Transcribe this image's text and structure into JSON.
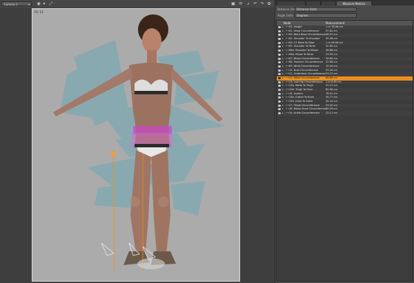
{
  "toolbar": {
    "camera_label": "Camera 1",
    "icons": [
      "pointer-icon",
      "frame-icon",
      "zoom-icon",
      "orbit-icon",
      "pan-icon",
      "roll-icon",
      "frame-all-icon",
      "settings-icon"
    ]
  },
  "viewport": {
    "resolution_label": "F0: 13"
  },
  "panel": {
    "tabs": [
      "",
      "",
      "",
      "Measure Metrics"
    ],
    "distance_units_label": "Distance Units",
    "distance_units_value": "Distance Units",
    "angle_units_label": "Angle Units",
    "angle_units_value": "Degrees",
    "columns": {
      "node": "Node",
      "measurement": "Measurement"
    },
    "rows": [
      {
        "name": "01. Height",
        "value": "1 m 78.58 cm"
      },
      {
        "name": "02. Head Circumference",
        "value": "57.62 cm"
      },
      {
        "name": "03. Neck Base Circumference",
        "value": "38.52 cm"
      },
      {
        "name": "04. Shoulder To Shoulder",
        "value": "39.28 cm"
      },
      {
        "name": "05. C7 Neck To Floor",
        "value": "1 m 48.06 cm"
      },
      {
        "name": "05. Shoulder To Wrist",
        "value": "52.85 cm"
      },
      {
        "name": "06a. Shoulder To Elbow",
        "value": "28.86 cm"
      },
      {
        "name": "06b. Elbow To Wrist",
        "value": "23.99 cm"
      },
      {
        "name": "07. Bicep Circumference",
        "value": "26.69 cm"
      },
      {
        "name": "08. Forearm Circumference",
        "value": "22.68 cm"
      },
      {
        "name": "09. Wrist Circumference",
        "value": "15.44 cm"
      },
      {
        "name": "10. Bust Circumference",
        "value": "93.26 cm"
      },
      {
        "name": "11. Underbust Circumference",
        "value": "73.27 cm"
      },
      {
        "name": "12. Waist Circumference",
        "value": "69.86 cm",
        "selected": true
      },
      {
        "name": "13. Low Hip Circumference",
        "value": "1 m 0.65 cm"
      },
      {
        "name": "13a. Waist To Thigh",
        "value": "31.17 cm"
      },
      {
        "name": "13b. Thigh To Floor",
        "value": "80.96 cm"
      },
      {
        "name": "14. Inseam",
        "value": "78.91 cm"
      },
      {
        "name": "15a. Crotch To Knee",
        "value": "34.77 cm"
      },
      {
        "name": "15b. Knee To Ankle",
        "value": "44.14 cm"
      },
      {
        "name": "17. Thigh Circumference",
        "value": "53.42 cm"
      },
      {
        "name": "18. Below Knee Circumference",
        "value": "33.39 cm"
      },
      {
        "name": "19. Ankle Circumference",
        "value": "22.11 cm"
      }
    ]
  }
}
